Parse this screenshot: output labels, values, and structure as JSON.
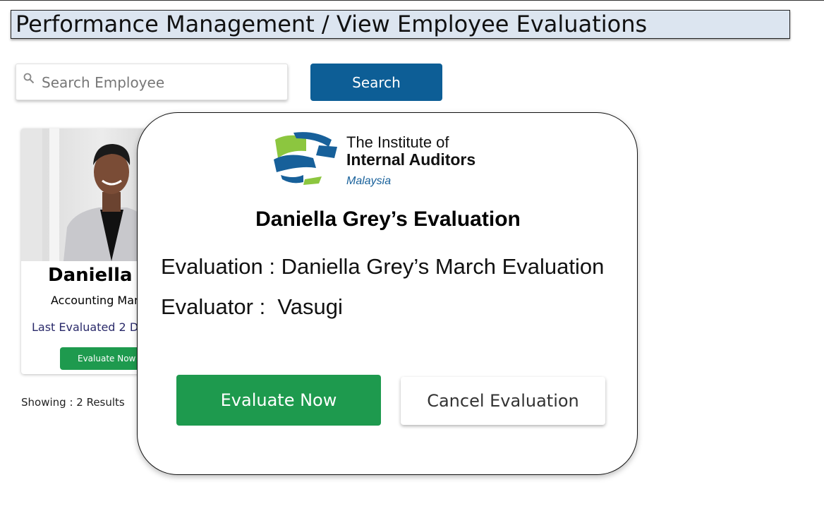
{
  "header": {
    "title": "Performance Management / View Employee Evaluations"
  },
  "search": {
    "placeholder": "Search Employee",
    "button_label": "Search"
  },
  "employee_card": {
    "name": "Daniella G",
    "role": "Accounting Man",
    "last_evaluated": "Last Evaluated 2 Da",
    "evaluate_button": "Evaluate Now"
  },
  "results": {
    "label": "Showing",
    "separator": " : ",
    "count": "2 Results"
  },
  "modal": {
    "logo": {
      "line1": "The Institute of",
      "line2": "Internal Auditors",
      "line3": "Malaysia"
    },
    "heading": "Daniella Grey’s Evaluation",
    "evaluation_line": "Evaluation : Daniella Grey’s March Evaluation",
    "evaluator_line": "Evaluator :  Vasugi",
    "evaluate_button": "Evaluate Now",
    "cancel_button": "Cancel Evaluation"
  },
  "colors": {
    "primary_blue": "#0d5e96",
    "evaluate_green": "#1e9a4e",
    "title_bar_bg": "#dce5f0",
    "logo_green": "#8cc63f",
    "logo_blue": "#17609a"
  },
  "icons": [
    "search-icon",
    "iia-logo-globe-icon"
  ]
}
